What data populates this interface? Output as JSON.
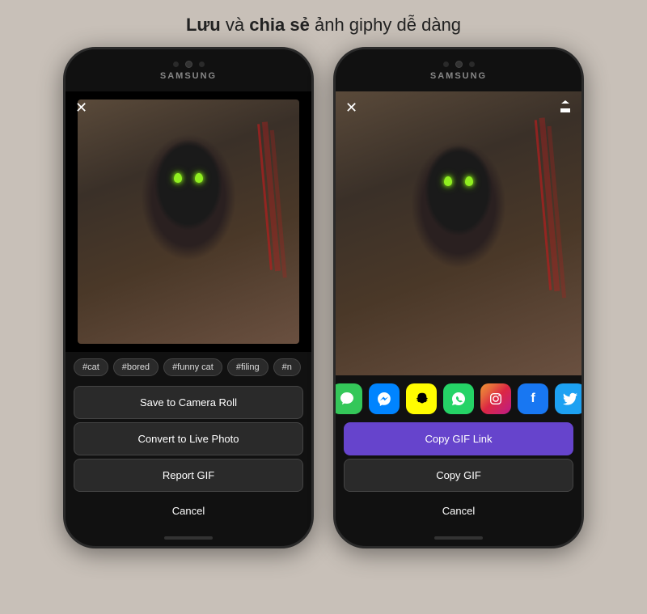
{
  "header": {
    "part1": "Lưu",
    "part2": "và",
    "part3": "chia sẻ",
    "part4": "ảnh giphy dễ dàng"
  },
  "phone_left": {
    "brand": "SAMSUNG",
    "hashtags": [
      "#cat",
      "#bored",
      "#funny cat",
      "#filing",
      "#n"
    ],
    "buttons": [
      {
        "label": "Save to Camera Roll",
        "style": "default"
      },
      {
        "label": "Convert to Live Photo",
        "style": "default"
      },
      {
        "label": "Report GIF",
        "style": "default"
      },
      {
        "label": "Cancel",
        "style": "cancel"
      }
    ],
    "close_icon": "✕"
  },
  "phone_right": {
    "brand": "SAMSUNG",
    "close_icon": "✕",
    "share_icon": "⬆",
    "social_icons": [
      {
        "name": "messages",
        "symbol": "💬"
      },
      {
        "name": "messenger",
        "symbol": "m"
      },
      {
        "name": "snapchat",
        "symbol": "👻"
      },
      {
        "name": "whatsapp",
        "symbol": "✔"
      },
      {
        "name": "instagram",
        "symbol": "📷"
      },
      {
        "name": "facebook",
        "symbol": "f"
      },
      {
        "name": "twitter",
        "symbol": "🐦"
      }
    ],
    "buttons": [
      {
        "label": "Copy GIF Link",
        "style": "purple"
      },
      {
        "label": "Copy GIF",
        "style": "default"
      },
      {
        "label": "Cancel",
        "style": "cancel"
      }
    ]
  }
}
